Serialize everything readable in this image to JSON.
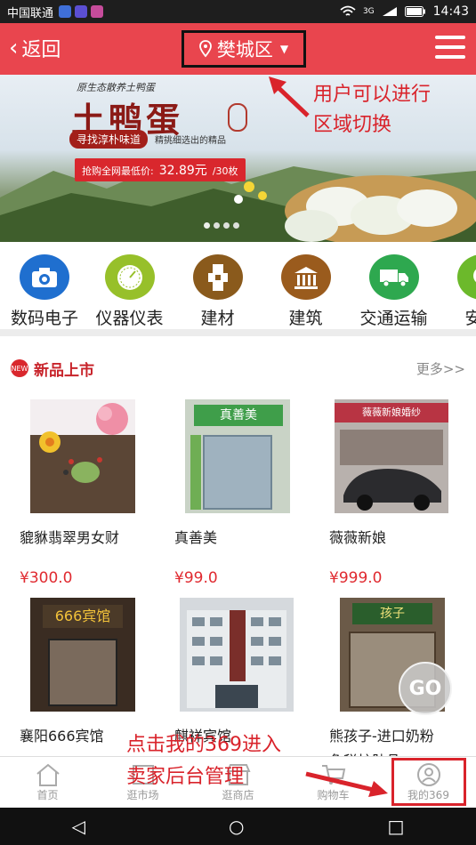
{
  "status_bar": {
    "carrier": "中国联通",
    "network": "3G",
    "time": "14:43"
  },
  "header": {
    "back_label": "返回",
    "location": "樊城区"
  },
  "banner": {
    "subtitle": "原生态散养土鸭蛋",
    "title": "土鸭蛋",
    "slogan": "寻找淳朴味道",
    "slogan_tail": "精挑细选出的精品",
    "price_label": "抢购全网最低价:",
    "price_value": "32.89元",
    "price_unit": "/30枚"
  },
  "annotations": {
    "region_hint": [
      "用户可以进行",
      "区域切换"
    ],
    "backend_hint": [
      "点击我的369进入",
      "卖家后台管理"
    ]
  },
  "categories": [
    {
      "label": "数码电子",
      "icon": "camera-icon",
      "color": "#1f6fcf"
    },
    {
      "label": "仪器仪表",
      "icon": "gauge-icon",
      "color": "#97c02a"
    },
    {
      "label": "建材",
      "icon": "pipe-icon",
      "color": "#8a5a1c"
    },
    {
      "label": "建筑",
      "icon": "building-icon",
      "color": "#9a5b1d"
    },
    {
      "label": "交通运输",
      "icon": "truck-icon",
      "color": "#2ea84f"
    },
    {
      "label": "安防",
      "icon": "camera-security-icon",
      "color": "#6cb92b"
    }
  ],
  "new_products": {
    "title": "新品上市",
    "badge": "NEW",
    "more": "更多>>",
    "items": [
      {
        "name": "貔貅翡翠男女财",
        "price": "¥300.0"
      },
      {
        "name": "真善美",
        "price": "¥99.0",
        "sign": "真善美"
      },
      {
        "name": "薇薇新娘",
        "price": "¥999.0",
        "sign": "薇薇新娘婚纱"
      },
      {
        "name": "襄阳666宾馆",
        "sign": "666宾馆"
      },
      {
        "name": "麒祥宾馆"
      },
      {
        "name": "熊孩子-进口奶粉",
        "name2": "免税护肤品",
        "sign": "孩子"
      }
    ]
  },
  "go_label": "GO",
  "tabs": [
    {
      "label": "首页"
    },
    {
      "label": "逛市场"
    },
    {
      "label": "逛商店"
    },
    {
      "label": "购物车"
    },
    {
      "label": "我的369"
    }
  ],
  "nav": {
    "back": "◁",
    "home": "○",
    "recent": "□"
  }
}
